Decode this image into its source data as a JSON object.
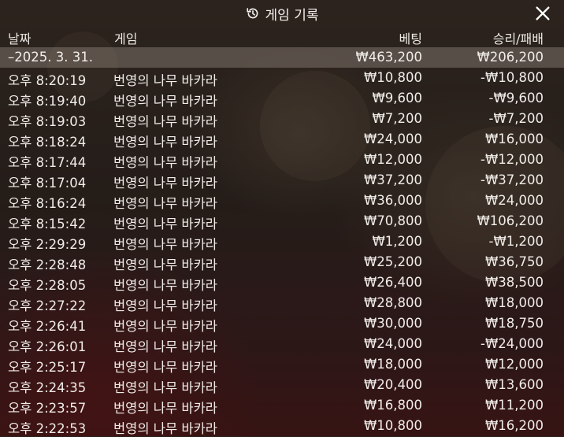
{
  "title": "게임 기록",
  "columns": {
    "date": "날짜",
    "game": "게임",
    "bet": "베팅",
    "result": "승리/패배"
  },
  "summary": {
    "date": "–2025. 3. 31.",
    "game": "",
    "bet": "₩463,200",
    "result": "₩206,200"
  },
  "rows": [
    {
      "date": "오후 8:20:19",
      "game": "번영의 나무 바카라",
      "bet": "₩10,800",
      "result": "-₩10,800"
    },
    {
      "date": "오후 8:19:40",
      "game": "번영의 나무 바카라",
      "bet": "₩9,600",
      "result": "-₩9,600"
    },
    {
      "date": "오후 8:19:03",
      "game": "번영의 나무 바카라",
      "bet": "₩7,200",
      "result": "-₩7,200"
    },
    {
      "date": "오후 8:18:24",
      "game": "번영의 나무 바카라",
      "bet": "₩24,000",
      "result": "₩16,000"
    },
    {
      "date": "오후 8:17:44",
      "game": "번영의 나무 바카라",
      "bet": "₩12,000",
      "result": "-₩12,000"
    },
    {
      "date": "오후 8:17:04",
      "game": "번영의 나무 바카라",
      "bet": "₩37,200",
      "result": "-₩37,200"
    },
    {
      "date": "오후 8:16:24",
      "game": "번영의 나무 바카라",
      "bet": "₩36,000",
      "result": "₩24,000"
    },
    {
      "date": "오후 8:15:42",
      "game": "번영의 나무 바카라",
      "bet": "₩70,800",
      "result": "₩106,200"
    },
    {
      "date": "오후 2:29:29",
      "game": "번영의 나무 바카라",
      "bet": "₩1,200",
      "result": "-₩1,200"
    },
    {
      "date": "오후 2:28:48",
      "game": "번영의 나무 바카라",
      "bet": "₩25,200",
      "result": "₩36,750"
    },
    {
      "date": "오후 2:28:05",
      "game": "번영의 나무 바카라",
      "bet": "₩26,400",
      "result": "₩38,500"
    },
    {
      "date": "오후 2:27:22",
      "game": "번영의 나무 바카라",
      "bet": "₩28,800",
      "result": "₩18,000"
    },
    {
      "date": "오후 2:26:41",
      "game": "번영의 나무 바카라",
      "bet": "₩30,000",
      "result": "₩18,750"
    },
    {
      "date": "오후 2:26:01",
      "game": "번영의 나무 바카라",
      "bet": "₩24,000",
      "result": "-₩24,000"
    },
    {
      "date": "오후 2:25:17",
      "game": "번영의 나무 바카라",
      "bet": "₩18,000",
      "result": "₩12,000"
    },
    {
      "date": "오후 2:24:35",
      "game": "번영의 나무 바카라",
      "bet": "₩20,400",
      "result": "₩13,600"
    },
    {
      "date": "오후 2:23:57",
      "game": "번영의 나무 바카라",
      "bet": "₩16,800",
      "result": "₩11,200"
    },
    {
      "date": "오후 2:22:53",
      "game": "번영의 나무 바카라",
      "bet": "₩10,800",
      "result": "₩16,200"
    }
  ],
  "icons": {
    "title_icon": "history-icon",
    "close": "close-icon"
  },
  "colors": {
    "text": "#f2eeea",
    "summary_row": "#8c837c",
    "backdrop": "#2a211c"
  }
}
